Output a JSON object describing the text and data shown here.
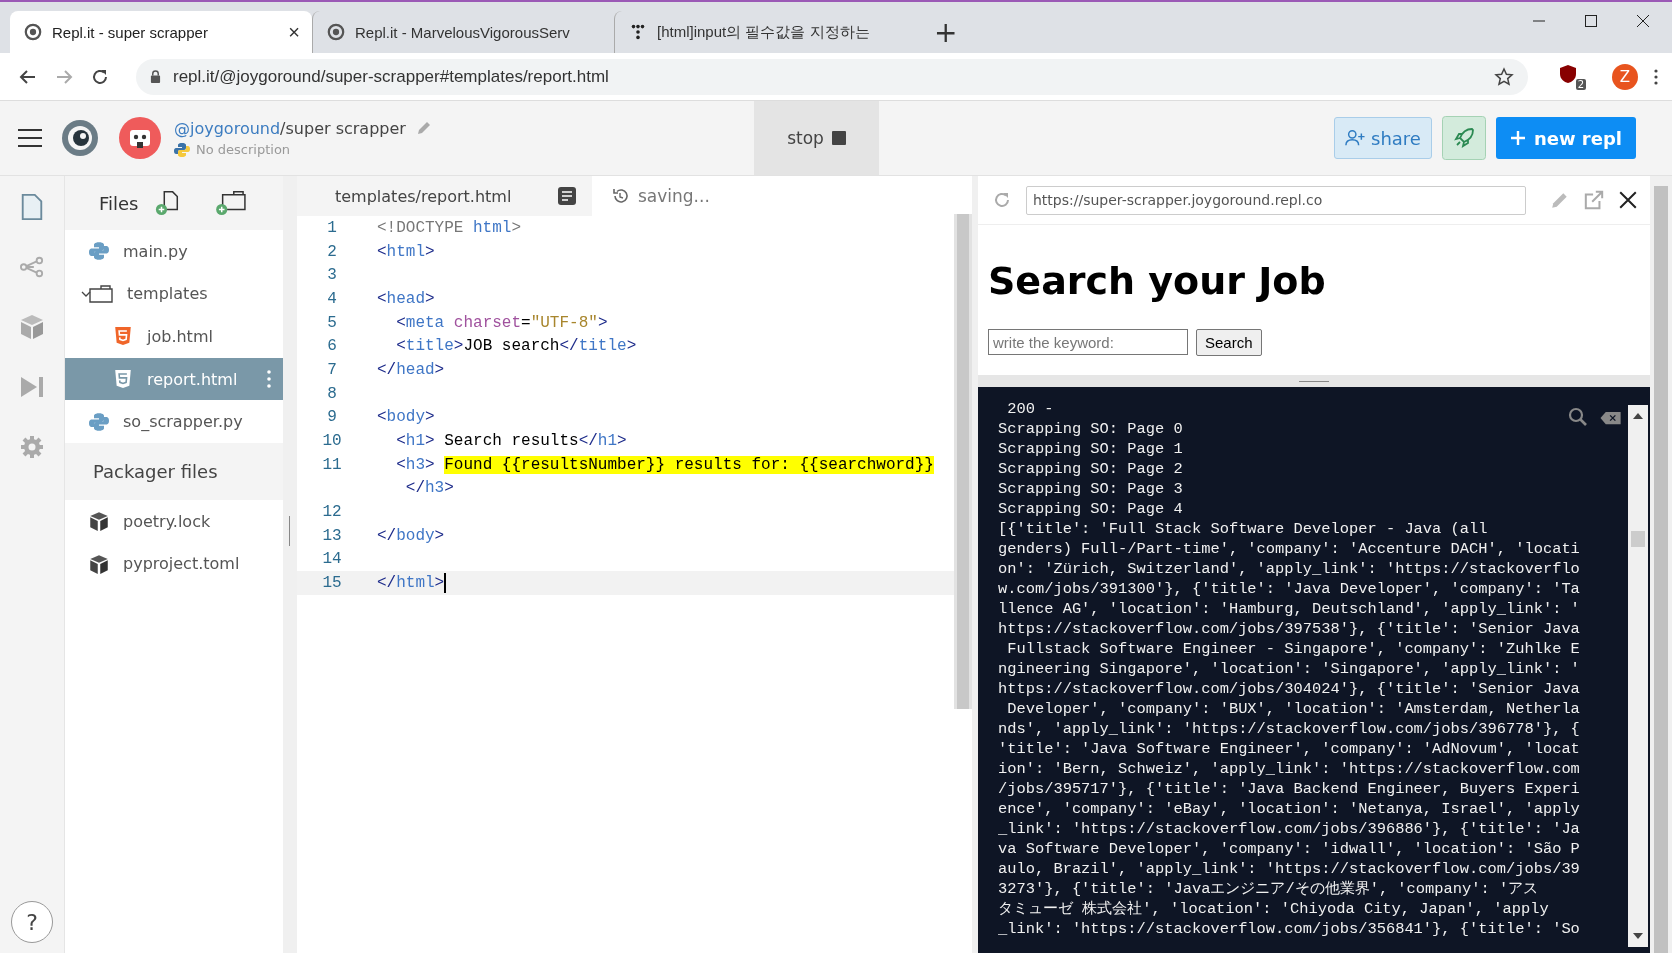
{
  "browser": {
    "tabs": [
      {
        "title": "Repl.it - super scrapper",
        "selected": true,
        "close": "×"
      },
      {
        "title": "Repl.it - MarvelousVigorousServ",
        "selected": false
      },
      {
        "title": "[html]input의 필수값을 지정하는",
        "selected": false
      }
    ],
    "new_tab": "+",
    "address": "repl.it/@joygoround/super-scrapper#templates/report.html",
    "extension_badge": "2",
    "profile": "Z"
  },
  "header": {
    "owner": "@joygoround",
    "repl_name": "/super scrapper",
    "description": "No description",
    "stop": "stop",
    "share": "share",
    "new_repl": "new repl"
  },
  "files": {
    "title": "Files",
    "items": [
      {
        "name": "main.py",
        "kind": "python",
        "selected": false
      },
      {
        "name": "templates",
        "kind": "folder",
        "expanded": true,
        "selected": false,
        "children": [
          {
            "name": "job.html",
            "kind": "html",
            "selected": false
          },
          {
            "name": "report.html",
            "kind": "html",
            "selected": true
          }
        ]
      },
      {
        "name": "so_scrapper.py",
        "kind": "python",
        "selected": false
      }
    ],
    "packager_title": "Packager files",
    "packager_items": [
      {
        "name": "poetry.lock",
        "kind": "package",
        "selected": false
      },
      {
        "name": "pyproject.toml",
        "kind": "package",
        "selected": false
      }
    ]
  },
  "help": "?",
  "editor": {
    "tab": "templates/report.html",
    "status": "saving...",
    "lines": [
      {
        "number": "1",
        "current": false,
        "tokens": [
          {
            "kind": "meta",
            "text": "<!DOCTYPE "
          },
          {
            "kind": "tag",
            "text": "html"
          },
          {
            "kind": "meta",
            "text": ">"
          }
        ]
      },
      {
        "number": "2",
        "current": false,
        "tokens": [
          {
            "kind": "bracket",
            "text": "<"
          },
          {
            "kind": "tag",
            "text": "html"
          },
          {
            "kind": "bracket",
            "text": ">"
          }
        ]
      },
      {
        "number": "3",
        "current": false
      },
      {
        "number": "4",
        "current": false,
        "tokens": [
          {
            "kind": "bracket",
            "text": "<"
          },
          {
            "kind": "tag",
            "text": "head"
          },
          {
            "kind": "bracket",
            "text": ">"
          }
        ]
      },
      {
        "number": "5",
        "current": false,
        "tokens": [
          {
            "kind": "bracket",
            "text": "  <"
          },
          {
            "kind": "tag",
            "text": "meta "
          },
          {
            "kind": "attr",
            "text": "charset"
          },
          {
            "kind": "text",
            "text": "="
          },
          {
            "kind": "string",
            "text": "\"UTF-8\""
          },
          {
            "kind": "bracket",
            "text": ">"
          }
        ]
      },
      {
        "number": "6",
        "current": false,
        "tokens": [
          {
            "kind": "bracket",
            "text": "  <"
          },
          {
            "kind": "tag",
            "text": "title"
          },
          {
            "kind": "bracket",
            "text": ">"
          },
          {
            "kind": "text",
            "text": "JOB search"
          },
          {
            "kind": "bracket",
            "text": "</"
          },
          {
            "kind": "tag",
            "text": "title"
          },
          {
            "kind": "bracket",
            "text": ">"
          }
        ]
      },
      {
        "number": "7",
        "current": false,
        "tokens": [
          {
            "kind": "bracket",
            "text": "</"
          },
          {
            "kind": "tag",
            "text": "head"
          },
          {
            "kind": "bracket",
            "text": ">"
          }
        ]
      },
      {
        "number": "8",
        "current": false
      },
      {
        "number": "9",
        "current": false,
        "tokens": [
          {
            "kind": "bracket",
            "text": "<"
          },
          {
            "kind": "tag",
            "text": "body"
          },
          {
            "kind": "bracket",
            "text": ">"
          }
        ]
      },
      {
        "number": "10",
        "current": false,
        "tokens": [
          {
            "kind": "bracket",
            "text": "  <"
          },
          {
            "kind": "tag",
            "text": "h1"
          },
          {
            "kind": "bracket",
            "text": ">"
          },
          {
            "kind": "text",
            "text": " Search results"
          },
          {
            "kind": "bracket",
            "text": "</"
          },
          {
            "kind": "tag",
            "text": "h1"
          },
          {
            "kind": "bracket",
            "text": ">"
          }
        ]
      },
      {
        "number": "11",
        "current": false,
        "tokens": [
          {
            "kind": "bracket",
            "text": "  <"
          },
          {
            "kind": "tag",
            "text": "h3"
          },
          {
            "kind": "bracket",
            "text": "> "
          },
          {
            "kind": "match",
            "text": "Found {{resultsNumber}} results for: {{searchword}}"
          }
        ],
        "wrap": [
          {
            "kind": "bracket",
            "text": "   </"
          },
          {
            "kind": "tag",
            "text": "h3"
          },
          {
            "kind": "bracket",
            "text": ">"
          }
        ]
      },
      {
        "number": "12",
        "current": false
      },
      {
        "number": "13",
        "current": false,
        "tokens": [
          {
            "kind": "bracket",
            "text": "</"
          },
          {
            "kind": "tag",
            "text": "body"
          },
          {
            "kind": "bracket",
            "text": ">"
          }
        ]
      },
      {
        "number": "14",
        "current": false
      },
      {
        "number": "15",
        "current": true,
        "tokens": [
          {
            "kind": "bracket",
            "text": "</"
          },
          {
            "kind": "tag",
            "text": "html"
          },
          {
            "kind": "bracket",
            "text": ">"
          }
        ]
      }
    ]
  },
  "preview": {
    "url": "https://super-scrapper.joygoround.repl.co",
    "heading": "Search your Job",
    "input_placeholder": "write the keyword:",
    "button": "Search"
  },
  "console": {
    "lines": [
      " 200 -",
      "Scrapping SO: Page 0",
      "Scrapping SO: Page 1",
      "Scrapping SO: Page 2",
      "Scrapping SO: Page 3",
      "Scrapping SO: Page 4",
      "[{'title': 'Full Stack Software Developer - Java (all",
      "genders) Full-/Part-time', 'company': 'Accenture DACH', 'locati",
      "on': 'Zürich, Switzerland', 'apply_link': 'https://stackoverflo",
      "w.com/jobs/391300'}, {'title': 'Java Developer', 'company': 'Ta",
      "llence AG', 'location': 'Hamburg, Deutschland', 'apply_link': '",
      "https://stackoverflow.com/jobs/397538'}, {'title': 'Senior Java",
      " Fullstack Software Engineer - Singapore', 'company': 'Zuhlke E",
      "ngineering Singapore', 'location': 'Singapore', 'apply_link': '",
      "https://stackoverflow.com/jobs/304024'}, {'title': 'Senior Java",
      " Developer', 'company': 'BUX', 'location': 'Amsterdam, Netherla",
      "nds', 'apply_link': 'https://stackoverflow.com/jobs/396778'}, {",
      "'title': 'Java Software Engineer', 'company': 'AdNovum', 'locat",
      "ion': 'Bern, Schweiz', 'apply_link': 'https://stackoverflow.com",
      "/jobs/395717'}, {'title': 'Java Backend Engineer, Buyers Experi",
      "ence', 'company': 'eBay', 'location': 'Netanya, Israel', 'apply",
      "_link': 'https://stackoverflow.com/jobs/396886'}, {'title': 'Ja",
      "va Software Developer', 'company': 'idwall', 'location': 'São P",
      "aulo, Brazil', 'apply_link': 'https://stackoverflow.com/jobs/39",
      "3273'}, {'title': 'Javaエンジニア/その他業界', 'company': 'アス",
      "タミューゼ 株式会社', 'location': 'Chiyoda City, Japan', 'apply",
      "_link': 'https://stackoverflow.com/jobs/356841'}, {'title': 'So"
    ]
  }
}
